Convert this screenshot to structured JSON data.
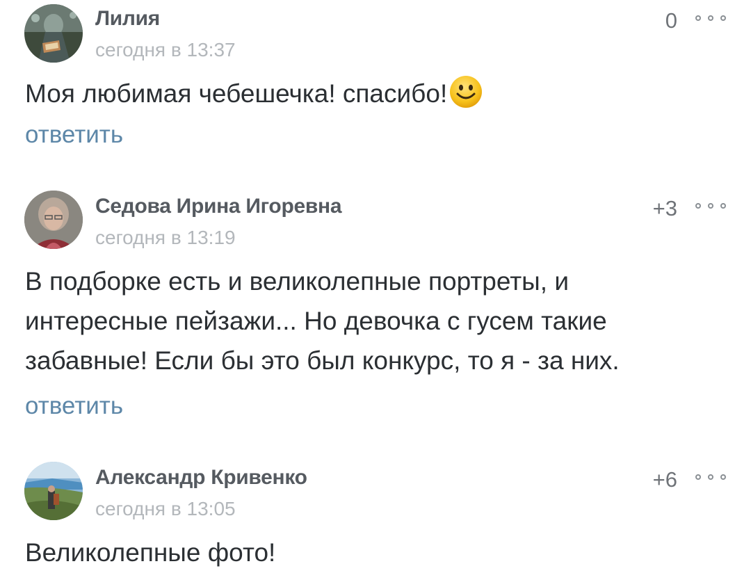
{
  "comments": [
    {
      "author": "Лилия",
      "time": "сегодня в 13:37",
      "score": "0",
      "text": "Моя любимая чебешечка! спасибо!",
      "emoji": "smiley-emoji",
      "reply_label": "ответить"
    },
    {
      "author": "Седова Ирина Игоревна",
      "time": "сегодня в 13:19",
      "score": "+3",
      "text": "В подборке есть и великолепные портреты, и интересные пейзажи... Но девочка с гусем такие забавные! Если бы это был конкурс, то я - за них.",
      "reply_label": "ответить"
    },
    {
      "author": "Александр Кривенко",
      "time": "сегодня в 13:05",
      "score": "+6",
      "text": "Великолепные фото!"
    }
  ],
  "colors": {
    "author": "#555a60",
    "time": "#b3b7bb",
    "text": "#2b2f33",
    "link": "#5d87a8",
    "score": "#6f7378"
  },
  "icons": {
    "more": "more-dots-icon",
    "emoji": "smiley-emoji"
  }
}
